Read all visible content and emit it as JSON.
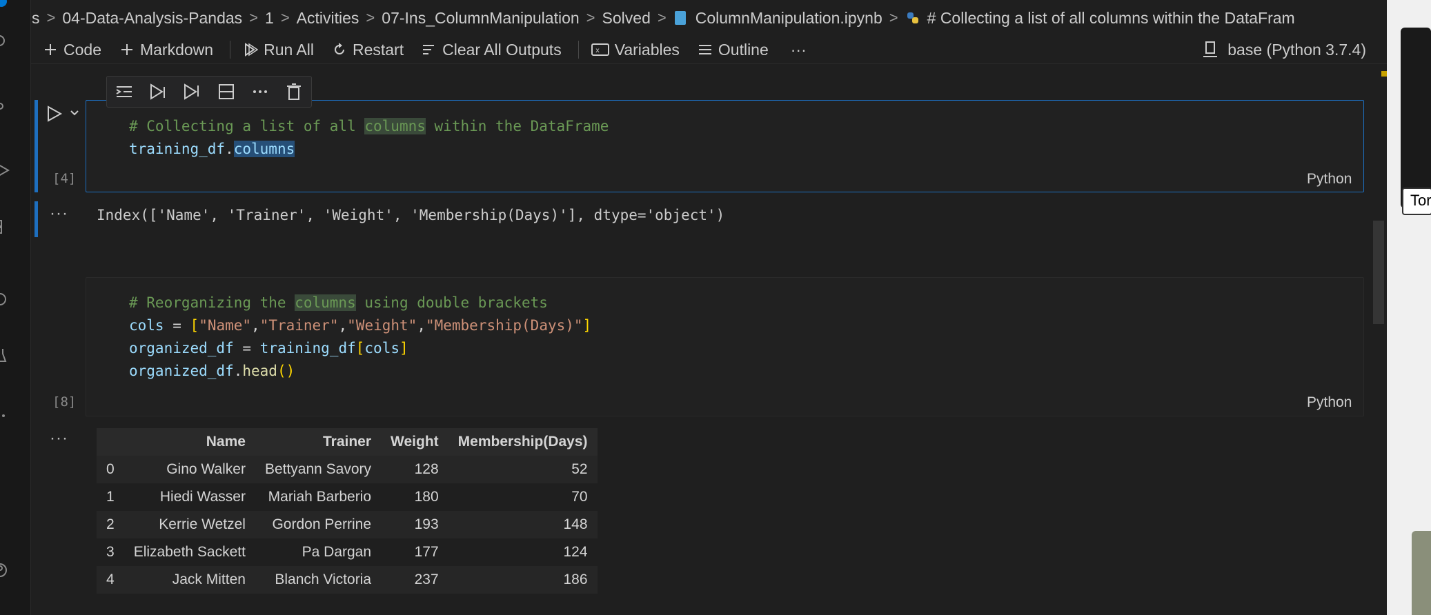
{
  "breadcrumb": [
    "s",
    "04-Data-Analysis-Pandas",
    "1",
    "Activities",
    "07-Ins_ColumnManipulation",
    "Solved",
    "ColumnManipulation.ipynb",
    "# Collecting a list of all columns within the DataFram"
  ],
  "toolbar": {
    "code": "Code",
    "markdown": "Markdown",
    "run_all": "Run All",
    "restart": "Restart",
    "clear_outputs": "Clear All Outputs",
    "variables": "Variables",
    "outline": "Outline",
    "more": "···",
    "kernel": "base (Python 3.7.4)"
  },
  "cells": [
    {
      "exec_count": "[4]",
      "language": "Python",
      "code_lines": [
        "# Collecting a list of all columns within the DataFrame",
        "training_df.columns"
      ],
      "output_marker": "···",
      "output_text": "Index(['Name', 'Trainer', 'Weight', 'Membership(Days)'], dtype='object')"
    },
    {
      "exec_count": "[8]",
      "language": "Python",
      "code_lines": [
        "# Reorganizing the columns using double brackets",
        "cols = [\"Name\",\"Trainer\",\"Weight\",\"Membership(Days)\"]",
        "organized_df = training_df[cols]",
        "organized_df.head()"
      ],
      "output_marker": "···"
    }
  ],
  "dataframe": {
    "columns": [
      "",
      "Name",
      "Trainer",
      "Weight",
      "Membership(Days)"
    ],
    "rows": [
      [
        "0",
        "Gino Walker",
        "Bettyann Savory",
        "128",
        "52"
      ],
      [
        "1",
        "Hiedi Wasser",
        "Mariah Barberio",
        "180",
        "70"
      ],
      [
        "2",
        "Kerrie Wetzel",
        "Gordon Perrine",
        "193",
        "148"
      ],
      [
        "3",
        "Elizabeth Sackett",
        "Pa Dargan",
        "177",
        "124"
      ],
      [
        "4",
        "Jack Mitten",
        "Blanch Victoria",
        "237",
        "186"
      ]
    ]
  },
  "video_overlay": {
    "label": "Tor"
  },
  "icons": {
    "activity_bar": [
      "search-icon",
      "source-control-icon",
      "run-debug-icon",
      "extensions-icon",
      "remote-icon",
      "testing-icon",
      "more-icon",
      "account-icon"
    ],
    "cell_toolbar": [
      "run-by-line-icon",
      "execute-above-icon",
      "execute-below-icon",
      "split-cell-icon",
      "more-actions-icon",
      "delete-cell-icon"
    ]
  },
  "colors": {
    "accent": "#0078d4",
    "cell_focus_border": "#1d6fc0",
    "comment": "#6a9955",
    "string": "#ce9178",
    "function": "#dcdcaa",
    "variable": "#9cdcfe"
  }
}
